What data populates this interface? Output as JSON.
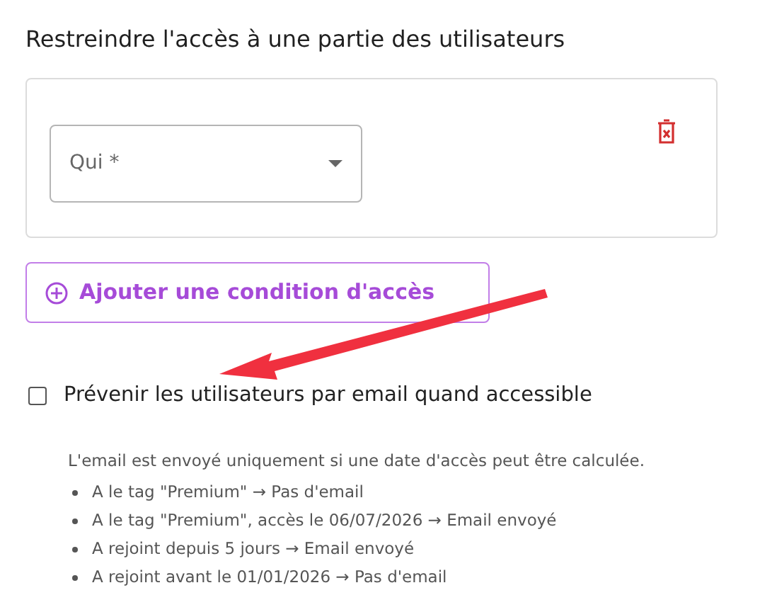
{
  "title": "Restreindre l'accès à une partie des utilisateurs",
  "condition": {
    "select": {
      "label": "Qui *"
    }
  },
  "add_button": {
    "label": "Ajouter une condition d'accès"
  },
  "notify": {
    "label": "Prévenir les utilisateurs par email quand accessible",
    "checked": false
  },
  "help": {
    "intro": "L'email est envoyé uniquement si une date d'accès peut être calculée.",
    "examples": [
      "A le tag \"Premium\" → Pas d'email",
      "A le tag \"Premium\", accès le 06/07/2026 → Email envoyé",
      "A rejoint depuis 5 jours → Email envoyé",
      "A rejoint avant le 01/01/2026 → Pas d'email"
    ]
  }
}
